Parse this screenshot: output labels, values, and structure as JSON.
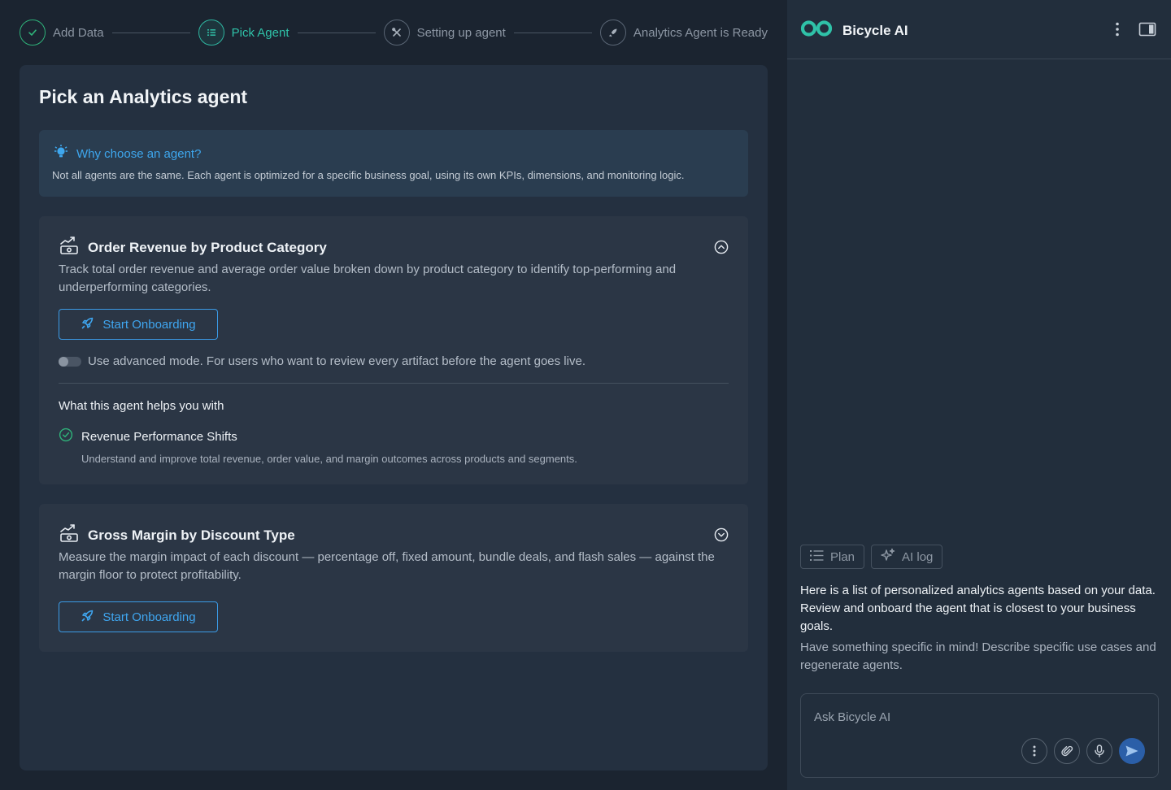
{
  "stepper": {
    "steps": [
      {
        "label": "Add Data",
        "state": "done",
        "icon": "check-icon"
      },
      {
        "label": "Pick Agent",
        "state": "active",
        "icon": "list-icon"
      },
      {
        "label": "Setting up agent",
        "state": "pending",
        "icon": "tools-icon"
      },
      {
        "label": "Analytics Agent is Ready",
        "state": "pending",
        "icon": "rocket-icon"
      }
    ]
  },
  "main": {
    "title": "Pick an Analytics agent",
    "info": {
      "title": "Why choose an agent?",
      "text": "Not all agents are the same. Each agent is optimized for a specific business goal, using its own KPIs, dimensions, and monitoring logic."
    },
    "agents": [
      {
        "title": "Order Revenue by Product Category",
        "description": "Track total order revenue and average order value broken down by product category to identify top-performing and underperforming categories.",
        "button_label": "Start Onboarding",
        "expanded": true,
        "advanced_mode_label": "Use advanced mode. For users who want to review every artifact before the agent goes live.",
        "advanced_mode_on": false,
        "helps_title": "What this agent helps you with",
        "feature": {
          "title": "Revenue Performance Shifts",
          "text": "Understand and improve total revenue, order value, and margin outcomes across products and segments."
        }
      },
      {
        "title": "Gross Margin by Discount Type",
        "description": "Measure the margin impact of each discount — percentage off, fixed amount, bundle deals, and flash sales — against the margin floor to protect profitability.",
        "button_label": "Start Onboarding",
        "expanded": false
      }
    ]
  },
  "assistant": {
    "name": "Bicycle AI",
    "chips": [
      {
        "label": "Plan",
        "icon": "list-icon"
      },
      {
        "label": "AI log",
        "icon": "sparkle-icon"
      }
    ],
    "message": "Here is a list of personalized analytics agents based on your data. Review and onboard the agent that is closest to your business goals.",
    "sub_message": "Have something specific in mind! Describe specific use cases and regenerate agents.",
    "input_placeholder": "Ask Bicycle AI",
    "input_value": ""
  },
  "colors": {
    "accent_blue": "#3fa6f0",
    "accent_teal": "#2fc2a8",
    "success_green": "#2fb37a",
    "send_button": "#2b5fa8"
  }
}
